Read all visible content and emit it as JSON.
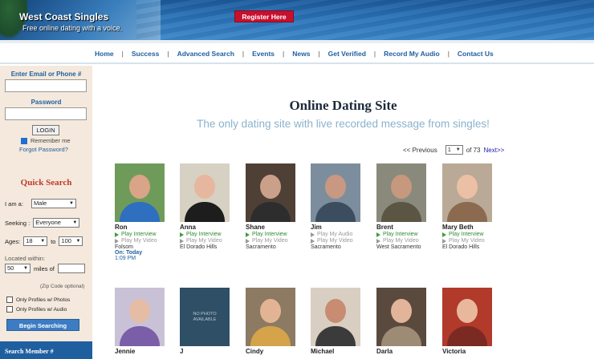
{
  "header": {
    "title": "West Coast Singles",
    "tagline": "Free online dating with a voice.",
    "register_label": "Register Here"
  },
  "nav": [
    "Home",
    "Success",
    "Advanced Search",
    "Events",
    "News",
    "Get Verified",
    "Record My Audio",
    "Contact Us"
  ],
  "sidebar": {
    "login_label": "Enter Email or Phone #",
    "password_label": "Password",
    "login_button": "LOGIN",
    "remember_label": "Remember me",
    "forgot_label": "Forgot Password?",
    "quick_search_title": "Quick Search",
    "i_am_label": "I am a:",
    "i_am_value": "Male",
    "seeking_label": "Seeking :",
    "seeking_value": "Everyone",
    "ages_label": "Ages:",
    "age_from": "18",
    "age_to_label": "to",
    "age_to": "100",
    "located_label": "Located within:",
    "miles_value": "50",
    "miles_label": "miles of",
    "zip_note": "(Zip Code optional)",
    "only_photos_label": "Only Profiles w/ Photos",
    "only_audio_label": "Only Profiles w/ Audio",
    "begin_button": "Begin Searching",
    "search_member_label": "Search Member #"
  },
  "main": {
    "title": "Online Dating Site",
    "subtitle": "The only dating site with live recorded message from singles!",
    "pager": {
      "prev": "<< Previous",
      "page": "1",
      "of": "of 73",
      "next": "Next>>"
    },
    "profiles_row1": [
      {
        "name": "Ron",
        "a1": "Play Interview",
        "a1_on": true,
        "a2": "Play My Video",
        "loc": "Folsom",
        "online": "On: Today",
        "online_time": "1:09 PM",
        "skin": "#d9a487",
        "bg": "#6f9b5a",
        "shirt": "#2f6fbf"
      },
      {
        "name": "Anna",
        "a1": "Play Interview",
        "a1_on": true,
        "a2": "Play My Video",
        "loc": "El Dorado Hills",
        "skin": "#e6b79e",
        "bg": "#d7d1c3",
        "shirt": "#1d1d1d"
      },
      {
        "name": "Shane",
        "a1": "Play Interview",
        "a1_on": true,
        "a2": "Play My Video",
        "loc": "Sacramento",
        "skin": "#caa08a",
        "bg": "#4f4036",
        "shirt": "#2d2d2d"
      },
      {
        "name": "Jim",
        "a1": "Play My Audio",
        "a1_on": false,
        "a2": "Play My Video",
        "loc": "Sacramento",
        "skin": "#c89882",
        "bg": "#7c8e9d",
        "shirt": "#3b4d5f"
      },
      {
        "name": "Brent",
        "a1": "Play Interview",
        "a1_on": true,
        "a2": "Play My Video",
        "loc": "West Sacramento",
        "skin": "#c6987e",
        "bg": "#8a8a7c",
        "shirt": "#5b5644"
      },
      {
        "name": "Mary Beth",
        "a1": "Play Interview",
        "a1_on": true,
        "a2": "Play My Video",
        "loc": "El Dorado Hills",
        "skin": "#ecc0a4",
        "bg": "#b9a996",
        "shirt": "#8c6a4f"
      }
    ],
    "profiles_row2": [
      {
        "name": "Jennie",
        "skin": "#e5bca4",
        "bg": "#c9c2d6",
        "shirt": "#7b5ea8"
      },
      {
        "name": "J",
        "nophoto": "NO PHOTO AVAILABLE"
      },
      {
        "name": "Cindy",
        "skin": "#e3b493",
        "bg": "#8c7a62",
        "shirt": "#d4a34a"
      },
      {
        "name": "Michael",
        "skin": "#c78c72",
        "bg": "#d8cfc2",
        "shirt": "#3b3b3b"
      },
      {
        "name": "Darla",
        "skin": "#e2b49a",
        "bg": "#5a4a3e",
        "shirt": "#9e8b75"
      },
      {
        "name": "Victoria",
        "skin": "#e9b89c",
        "bg": "#b23a2a",
        "shirt": "#7a2a22"
      }
    ]
  },
  "colors": {
    "nav_link": "#1f5fa0",
    "register": "#c8102e",
    "quick_search": "#c0392b",
    "play_on": "#2e8b2e"
  }
}
